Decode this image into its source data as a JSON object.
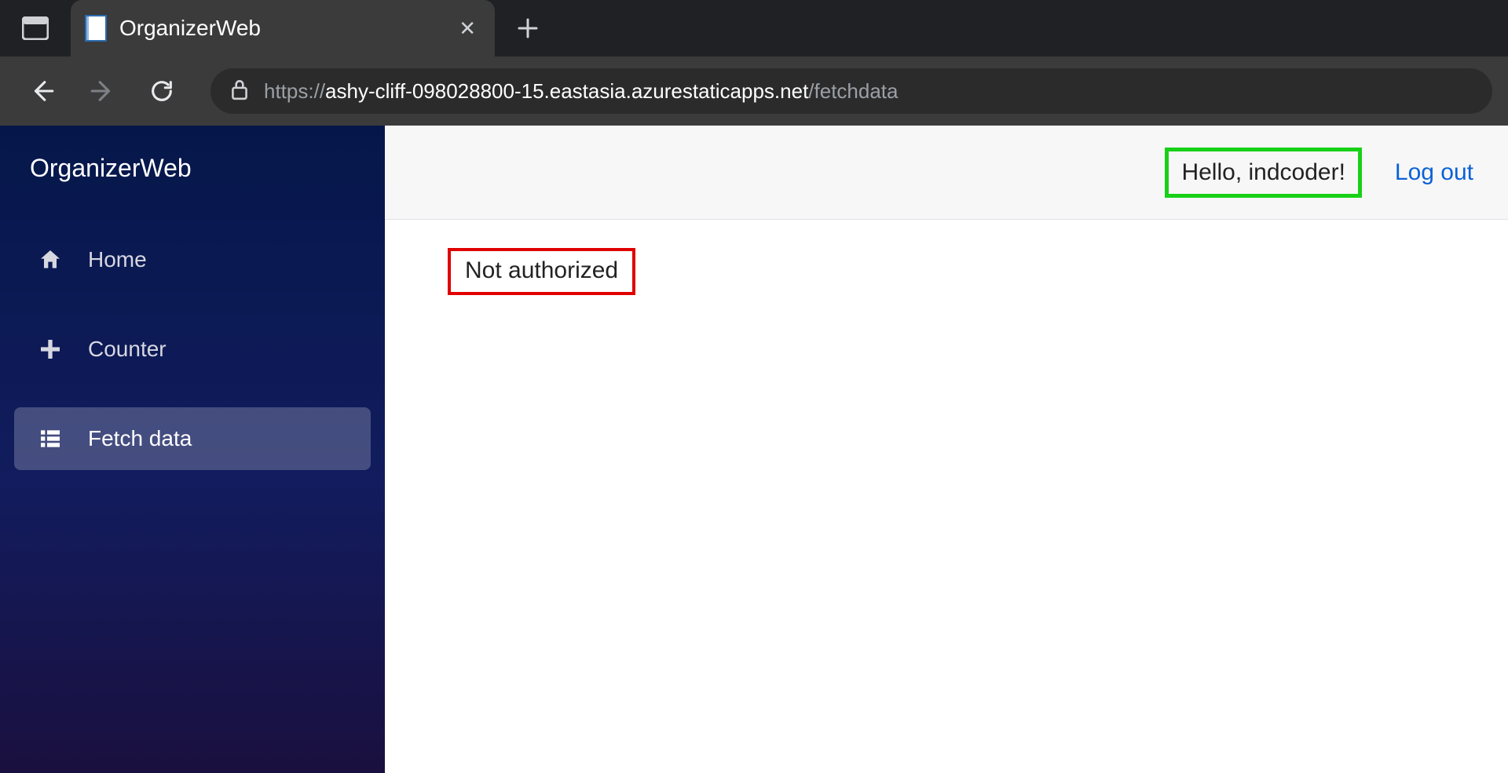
{
  "browser": {
    "tab_title": "OrganizerWeb",
    "url_scheme": "https://",
    "url_host": "ashy-cliff-098028800-15.eastasia.azurestaticapps.net",
    "url_path": "/fetchdata"
  },
  "sidebar": {
    "brand": "OrganizerWeb",
    "items": [
      {
        "label": "Home",
        "icon": "home",
        "active": false
      },
      {
        "label": "Counter",
        "icon": "plus",
        "active": false
      },
      {
        "label": "Fetch data",
        "icon": "list",
        "active": true
      }
    ]
  },
  "topbar": {
    "greeting": "Hello, indcoder!",
    "logout_label": "Log out"
  },
  "content": {
    "message": "Not authorized"
  },
  "annotations": {
    "greeting_box_color": "#18d018",
    "message_box_color": "#e00000"
  }
}
